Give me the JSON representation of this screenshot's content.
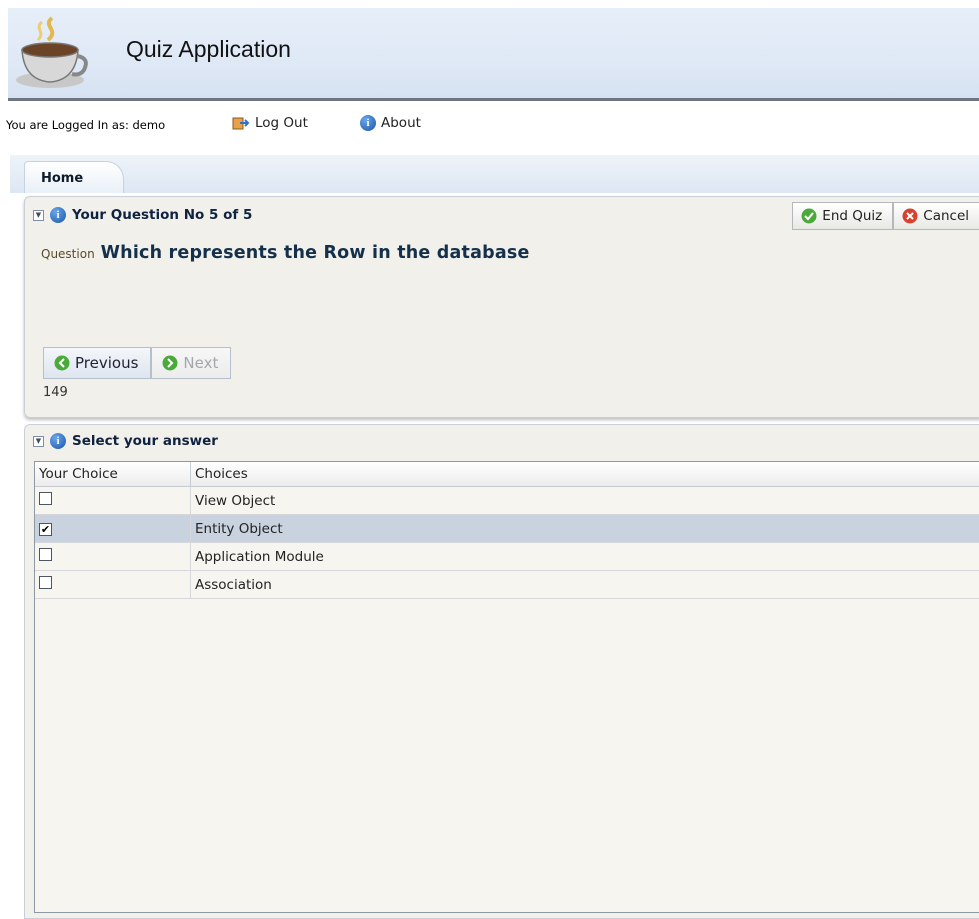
{
  "app": {
    "title": "Quiz Application",
    "logo_icon": "coffee-cup-icon"
  },
  "session": {
    "logged_in_text": "You are Logged In as: demo",
    "logout_label": "Log Out",
    "about_label": "About"
  },
  "tabs": [
    {
      "label": "Home"
    }
  ],
  "question_panel": {
    "title": "Your Question No 5 of 5",
    "end_quiz_label": "End Quiz",
    "cancel_label": "Cancel",
    "question_label": "Question",
    "question_text": "Which represents the Row in the database",
    "previous_label": "Previous",
    "next_label": "Next",
    "counter": "149"
  },
  "answer_panel": {
    "title": "Select your answer",
    "columns": [
      "Your Choice",
      "Choices"
    ],
    "rows": [
      {
        "checked": "",
        "choice": "View Object"
      },
      {
        "checked": "✔",
        "choice": "Entity Object"
      },
      {
        "checked": "",
        "choice": "Application Module"
      },
      {
        "checked": "",
        "choice": "Association"
      }
    ]
  },
  "colors": {
    "selected_row": "#c9d2df",
    "panel_bg": "#f1f0ea",
    "header_bg": "#dfe9f6"
  }
}
